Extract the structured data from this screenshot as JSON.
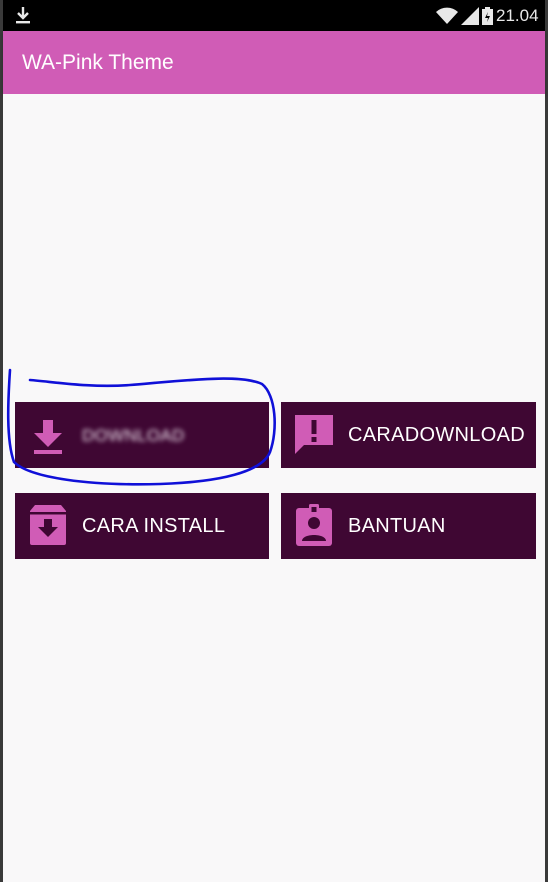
{
  "status_bar": {
    "time": "21.04",
    "icons": [
      "download-icon",
      "wifi-icon",
      "signal-icon",
      "battery-icon"
    ]
  },
  "app_bar": {
    "title": "WA-Pink Theme",
    "color": "#d05cb6"
  },
  "buttons": {
    "download": {
      "label": "DOWNLOAD",
      "icon": "download-icon"
    },
    "cara_download": {
      "label_visible": "CARA",
      "label_blurred": "DOWNLOAD",
      "icon": "feedback-icon"
    },
    "cara_install": {
      "label": "CARA INSTALL",
      "icon": "archive-icon"
    },
    "bantuan": {
      "label": "BANTUAN",
      "icon": "contact-badge-icon"
    }
  },
  "colors": {
    "button_bg": "#3f0733",
    "icon_pink": "#d05cb6",
    "annotation_blue": "#1010d8"
  }
}
